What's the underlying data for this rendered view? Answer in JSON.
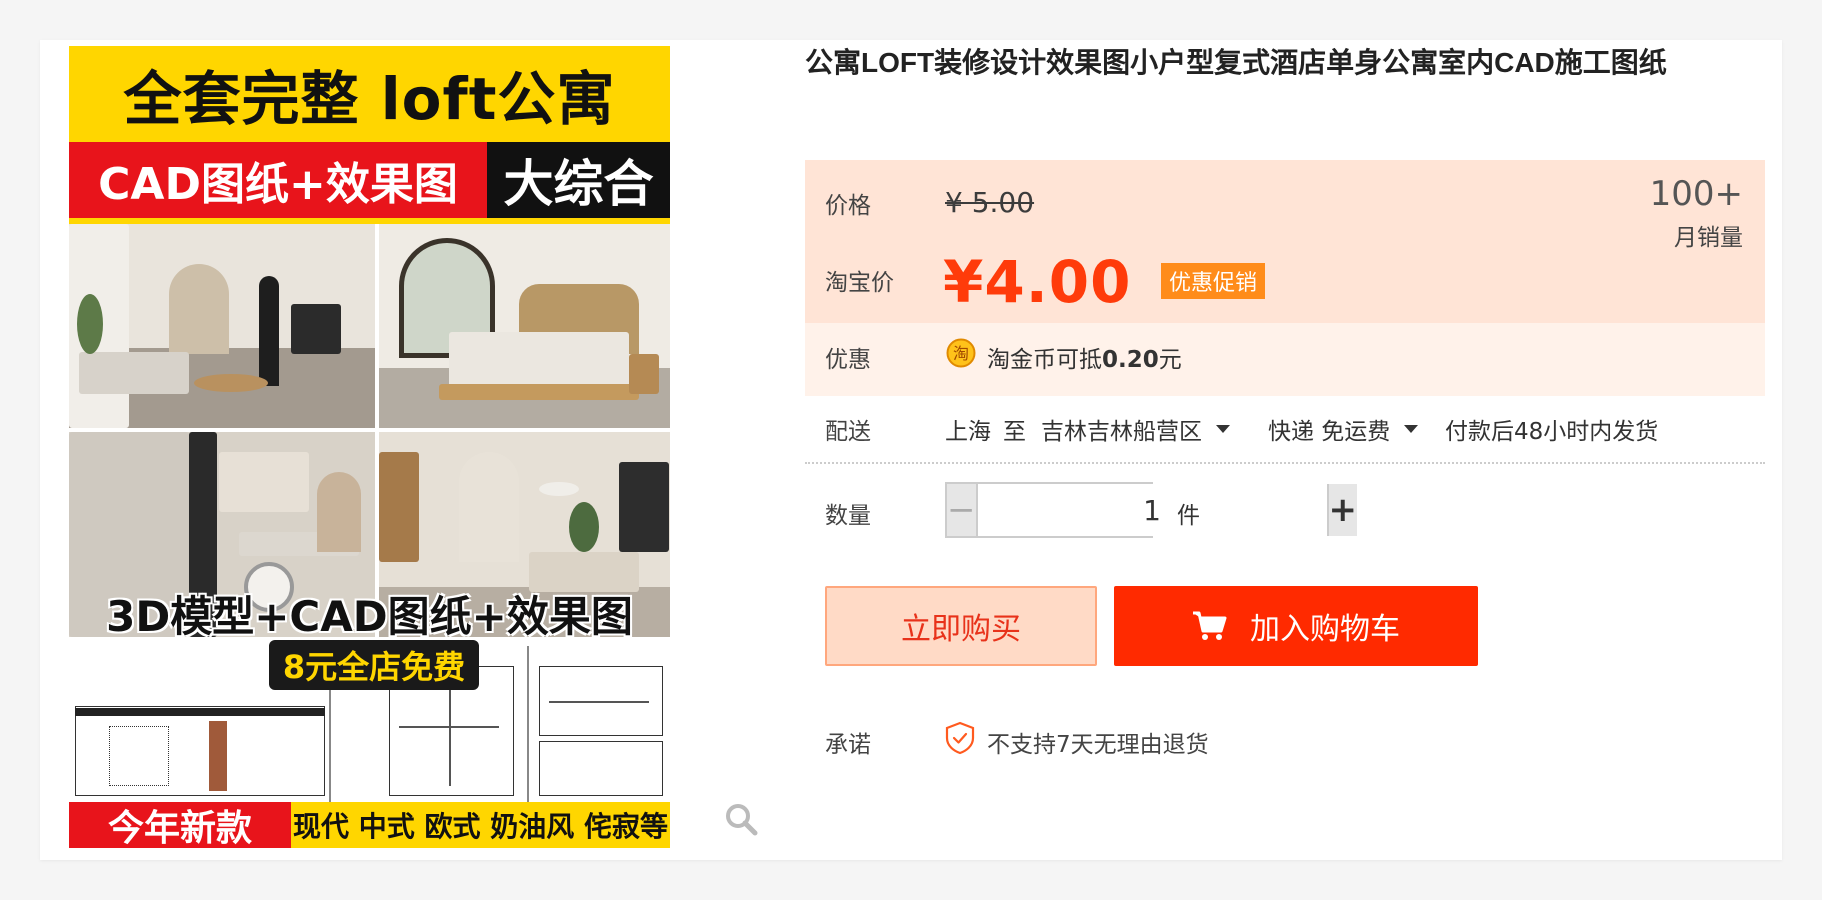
{
  "gallery": {
    "top_banner": "全套完整 loft公寓",
    "band_left": "CAD图纸+效果图",
    "band_right": "大综合",
    "caption": "3D模型+CAD图纸+效果图",
    "free_tag": "8元全店免费",
    "bottom_left": "今年新款",
    "bottom_right": "现代 中式 欧式 奶油风 侘寂等"
  },
  "product": {
    "title": "公寓LOFT装修设计效果图小户型复式酒店单身公寓室内CAD施工图纸"
  },
  "price": {
    "label": "价格",
    "original": "¥ 5.00",
    "taobao_label": "淘宝价",
    "current": "¥4.00",
    "promo_tag": "优惠促销",
    "sales_count": "100+",
    "sales_label": "月销量"
  },
  "discount": {
    "label": "优惠",
    "coin_glyph": "淘",
    "text_prefix": "淘金币可抵",
    "amount": "0.20",
    "text_suffix": "元"
  },
  "shipping": {
    "label": "配送",
    "from": "上海",
    "to_word": "至",
    "destination": "吉林吉林船营区",
    "method": "快递 免运费",
    "dispatch": "付款后48小时内发货"
  },
  "quantity": {
    "label": "数量",
    "minus": "−",
    "value": "1",
    "plus": "+",
    "unit": "件"
  },
  "actions": {
    "buy_now": "立即购买",
    "add_to_cart": "加入购物车"
  },
  "promise": {
    "label": "承诺",
    "text": "不支持7天无理由退货"
  },
  "colors": {
    "accent": "#ff2a00",
    "price_red": "#ff3b0a",
    "promo_orange": "#ff8c1a",
    "panel_bg": "#fff2ea"
  },
  "icons": [
    "search-icon",
    "coin-icon",
    "cart-icon",
    "shield-check-icon",
    "caret-down-icon"
  ]
}
